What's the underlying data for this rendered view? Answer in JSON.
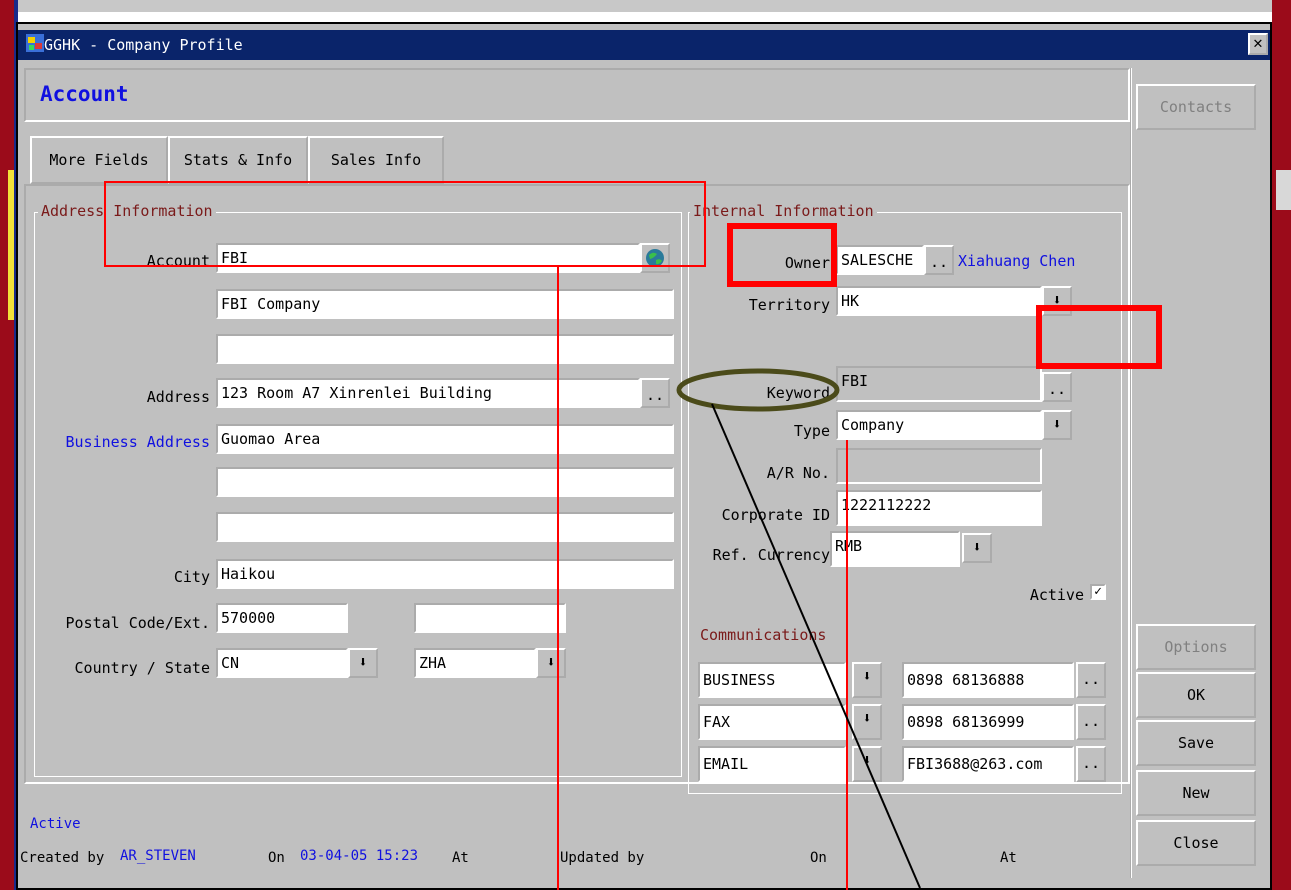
{
  "window": {
    "title": "GGHK - Company Profile",
    "close": "x"
  },
  "header": {
    "title": "Account"
  },
  "tabs": [
    "More Fields",
    "Stats & Info",
    "Sales Info"
  ],
  "address": {
    "group_label": "Address Information",
    "account_label": "Account",
    "account_value": "FBI",
    "name_value": "FBI Company",
    "name2_value": "",
    "address_label": "Address",
    "address_value": "123 Room A7 Xinrenlei Building",
    "business_address_label": "Business Address",
    "business_address_value": "Guomao Area",
    "line3_value": "",
    "line4_value": "",
    "city_label": "City",
    "city_value": "Haikou",
    "postal_label": "Postal Code/Ext.",
    "postal_value": "570000",
    "postal_ext_value": "",
    "country_label": "Country / State",
    "country_value": "CN",
    "state_value": "ZHA"
  },
  "internal": {
    "group_label": "Internal Information",
    "owner_label": "Owner",
    "owner_value": "SALESCHE",
    "owner_name": "Xiahuang Chen",
    "territory_label": "Territory",
    "territory_value": "HK",
    "keyword_label": "Keyword",
    "keyword_value": "FBI",
    "type_label": "Type",
    "type_value": "Company",
    "ar_label": "A/R No.",
    "ar_value": "",
    "corporate_label": "Corporate ID",
    "corporate_value": "1222112222",
    "currency_label": "Ref. Currency",
    "currency_value": "RMB",
    "active_label": "Active",
    "active_checked": true
  },
  "communications": {
    "label": "Communications",
    "rows": [
      {
        "type": "BUSINESS",
        "value": "0898 68136888"
      },
      {
        "type": "FAX",
        "value": "0898 68136999"
      },
      {
        "type": "EMAIL",
        "value": "FBI3688@263.com"
      }
    ]
  },
  "sidebar": {
    "contacts": "Contacts",
    "options": "Options",
    "ok": "OK",
    "save": "Save",
    "new": "New",
    "close": "Close"
  },
  "footer": {
    "status": "Active",
    "created_by_label": "Created by",
    "created_by": "AR_STEVEN",
    "on_label": "On",
    "created_on": "03-04-05 15:23",
    "at_label": "At",
    "updated_by_label": "Updated by",
    "on2_label": "On",
    "at2_label": "At"
  },
  "colors": {
    "title_bar": "#0a246a",
    "accent_blue": "#1010e0",
    "annotation_red": "#ff0000",
    "annotation_olive": "#4b4b1a"
  },
  "icons": {
    "app": "app-icon",
    "globe": "globe-icon",
    "dropdown": "dropdown-arrow-icon",
    "ellipsis": "ellipsis-icon",
    "check": "checkmark-icon"
  }
}
